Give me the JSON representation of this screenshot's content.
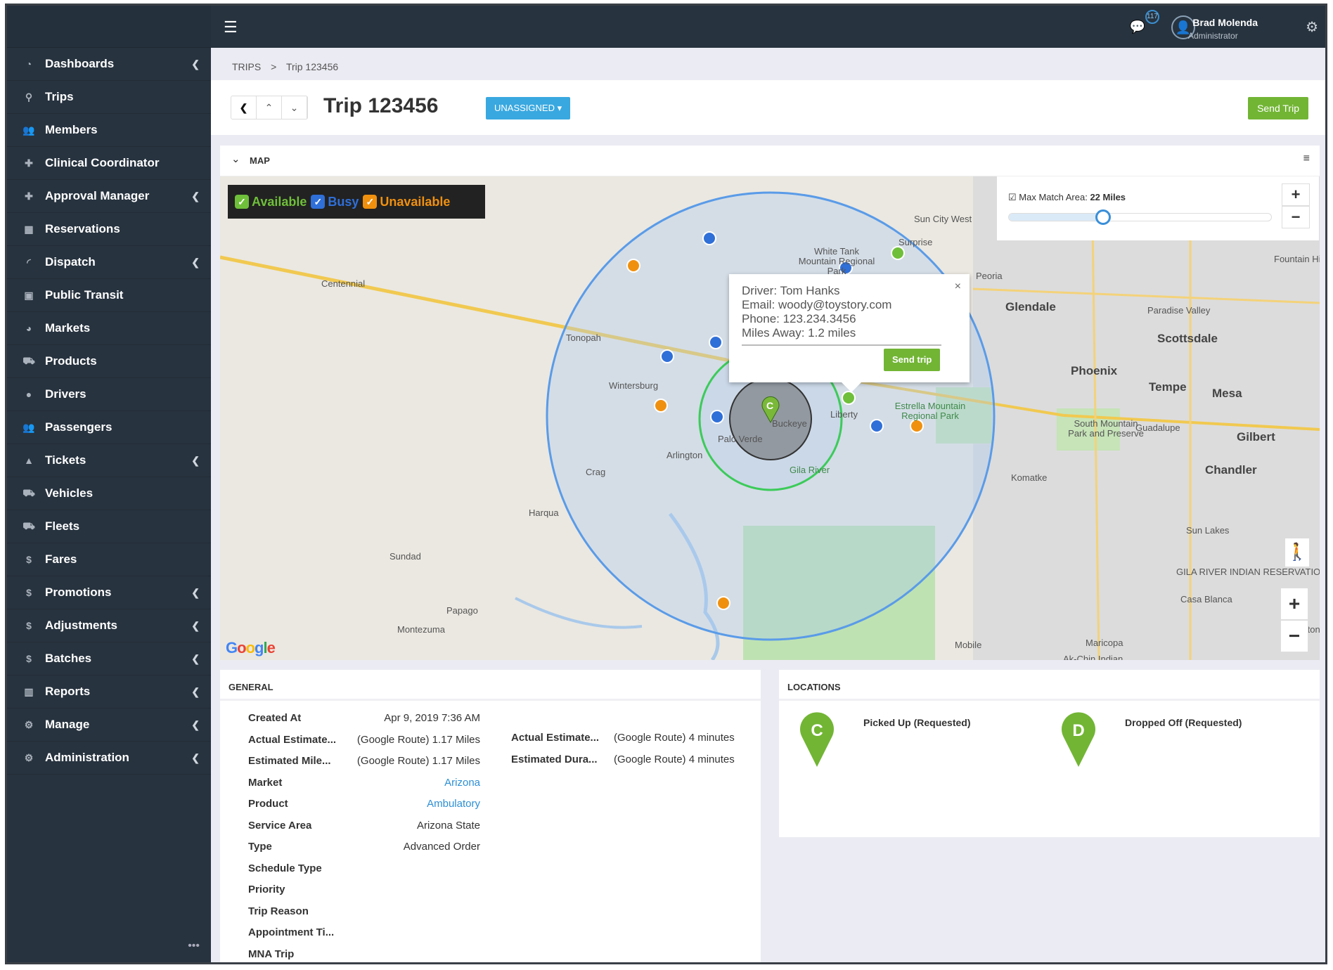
{
  "colors": {
    "sidebar": "#27333f",
    "accent_green": "#72b535",
    "accent_blue": "#39a8e0",
    "available": "#6fbf3a",
    "busy": "#2f6fd8",
    "unavailable": "#f0900f"
  },
  "sidebar": {
    "items": [
      {
        "label": "Dashboards",
        "icon": "dashboard-icon",
        "chevron": true
      },
      {
        "label": "Trips",
        "icon": "map-pin-icon",
        "chevron": false
      },
      {
        "label": "Members",
        "icon": "people-icon",
        "chevron": false
      },
      {
        "label": "Clinical Coordinator",
        "icon": "medkit-icon",
        "chevron": false
      },
      {
        "label": "Approval Manager",
        "icon": "medkit-icon",
        "chevron": true
      },
      {
        "label": "Reservations",
        "icon": "calendar-icon",
        "chevron": false
      },
      {
        "label": "Dispatch",
        "icon": "rss-icon",
        "chevron": true
      },
      {
        "label": "Public Transit",
        "icon": "bus-icon",
        "chevron": false
      },
      {
        "label": "Markets",
        "icon": "pie-chart-icon",
        "chevron": false
      },
      {
        "label": "Products",
        "icon": "car-icon",
        "chevron": false
      },
      {
        "label": "Drivers",
        "icon": "user-icon",
        "chevron": false
      },
      {
        "label": "Passengers",
        "icon": "people-icon",
        "chevron": false
      },
      {
        "label": "Tickets",
        "icon": "lock-icon",
        "chevron": true
      },
      {
        "label": "Vehicles",
        "icon": "car-icon",
        "chevron": false
      },
      {
        "label": "Fleets",
        "icon": "car-icon",
        "chevron": false
      },
      {
        "label": "Fares",
        "icon": "dollar-icon",
        "chevron": false
      },
      {
        "label": "Promotions",
        "icon": "dollar-icon",
        "chevron": true
      },
      {
        "label": "Adjustments",
        "icon": "dollar-icon",
        "chevron": true
      },
      {
        "label": "Batches",
        "icon": "dollar-icon",
        "chevron": true
      },
      {
        "label": "Reports",
        "icon": "bar-chart-icon",
        "chevron": true
      },
      {
        "label": "Manage",
        "icon": "gear-icon",
        "chevron": true
      },
      {
        "label": "Administration",
        "icon": "gears-icon",
        "chevron": true
      }
    ],
    "more": "•••"
  },
  "topbar": {
    "notifications": "117",
    "user_name": "Brad Molenda",
    "user_role": "Administrator"
  },
  "breadcrumb": [
    "TRIPS",
    ">",
    "Trip 123456"
  ],
  "trip": {
    "title": "Trip 123456",
    "status": "UNASSIGNED ▾",
    "send_label": "Send Trip"
  },
  "map": {
    "header": "MAP",
    "legend": [
      {
        "label": "Available",
        "color": "#6fbf3a"
      },
      {
        "label": "Busy",
        "color": "#2f6fd8"
      },
      {
        "label": "Unavailable",
        "color": "#f0900f"
      }
    ],
    "max_match": {
      "label": "Max Match Area:",
      "value": "22 Miles",
      "checked": true,
      "slider_fraction": 0.36
    },
    "popup": {
      "driver": "Driver: Tom Hanks",
      "email": "Email: woody@toystory.com",
      "phone": "Phone: 123.234.3456",
      "miles": "Miles Away: 1.2 miles",
      "button": "Send trip",
      "close": "×"
    },
    "labels": [
      "Centennial",
      "Tonopah",
      "Wintersburg",
      "Arlington",
      "Crag",
      "Harqua",
      "Sundad",
      "Papago",
      "Montezuma",
      "White Tank Mountain Regional Park",
      "Sun City West",
      "Surprise",
      "Peoria",
      "Glendale",
      "Phoenix",
      "Scottsdale",
      "Paradise Valley",
      "Fountain Hills",
      "Tempe",
      "Mesa",
      "Gilbert",
      "Chandler",
      "South Mountain Park and Preserve",
      "Guadalupe",
      "Komatke",
      "Estrella Mountain Regional Park",
      "Liberty",
      "Buckeye",
      "Palo Verde",
      "Sun Lakes",
      "GILA RIVER INDIAN RESERVATION",
      "Casa Blanca",
      "Maricopa",
      "Ak-Chin Indian",
      "Mobile",
      "Sacaton",
      "Gila River"
    ],
    "attribution": "Google",
    "markers": {
      "available": 3,
      "busy": 6,
      "unavailable": 4
    }
  },
  "general": {
    "header": "GENERAL",
    "rows": [
      {
        "k": "Created At",
        "v": "Apr 9, 2019 7:36 AM"
      },
      {
        "k": "Actual Estimate...",
        "v": "(Google Route) 1.17 Miles"
      },
      {
        "k": "Estimated Mile...",
        "v": "(Google Route) 1.17 Miles"
      },
      {
        "k": "Market",
        "v": "Arizona",
        "link": true
      },
      {
        "k": "Product",
        "v": "Ambulatory",
        "link": true
      },
      {
        "k": "Service Area",
        "v": "Arizona State"
      },
      {
        "k": "Type",
        "v": "Advanced Order"
      },
      {
        "k": "Schedule Type",
        "v": ""
      },
      {
        "k": "Priority",
        "v": ""
      },
      {
        "k": "Trip Reason",
        "v": ""
      },
      {
        "k": "Appointment Ti...",
        "v": ""
      },
      {
        "k": "MNA Trip",
        "v": ""
      }
    ],
    "right_rows": [
      {
        "k": "Actual Estimate...",
        "v": "(Google Route) 4 minutes"
      },
      {
        "k": "Estimated Dura...",
        "v": "(Google Route) 4 minutes"
      }
    ]
  },
  "locations": {
    "header": "LOCATIONS",
    "items": [
      {
        "letter": "C",
        "label": "Picked Up (Requested)"
      },
      {
        "letter": "D",
        "label": "Dropped Off (Requested)"
      }
    ]
  }
}
